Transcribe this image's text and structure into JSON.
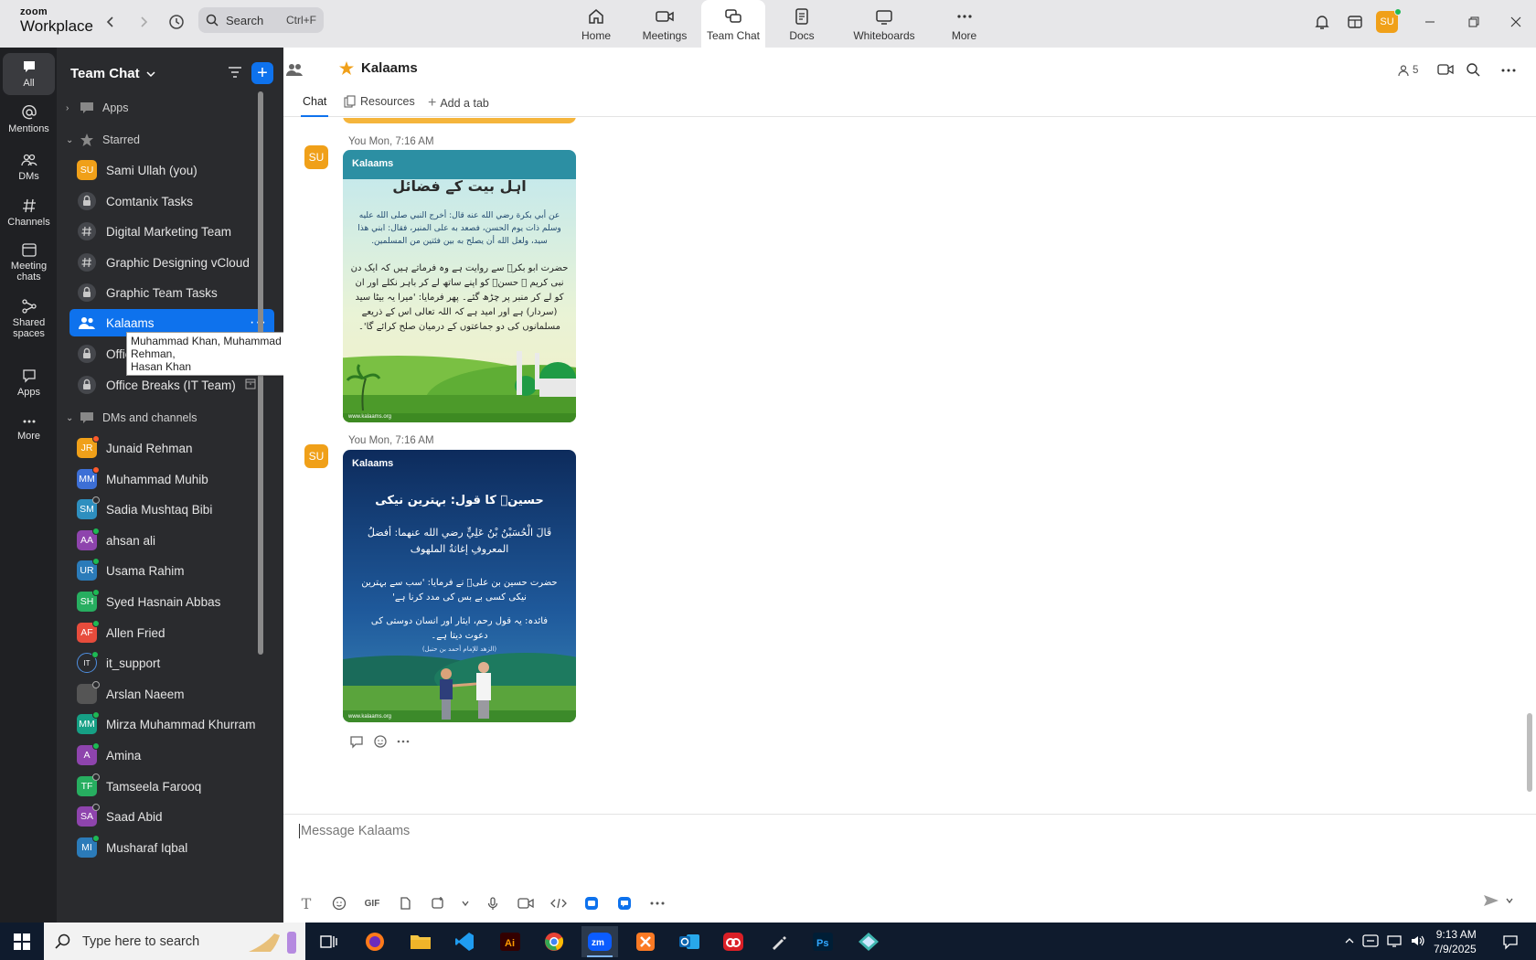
{
  "app": {
    "logo_top": "zoom",
    "logo_bottom": "Workplace"
  },
  "search": {
    "placeholder": "Search",
    "shortcut": "Ctrl+F"
  },
  "nav_tabs": [
    {
      "label": "Home",
      "icon": "home-icon"
    },
    {
      "label": "Meetings",
      "icon": "video-camera-icon"
    },
    {
      "label": "Team Chat",
      "icon": "chat-bubbles-icon",
      "active": true
    },
    {
      "label": "Docs",
      "icon": "document-icon"
    },
    {
      "label": "Whiteboards",
      "icon": "whiteboard-icon"
    },
    {
      "label": "More",
      "icon": "more-dots-icon"
    }
  ],
  "user": {
    "initials": "SU"
  },
  "rail": [
    {
      "label": "All",
      "icon": "chat-icon",
      "active": true
    },
    {
      "label": "Mentions",
      "icon": "at-icon"
    },
    {
      "label": "DMs",
      "icon": "people-icon"
    },
    {
      "label": "Channels",
      "icon": "hash-icon"
    },
    {
      "label": "Meeting chats",
      "icon": "calendar-icon"
    },
    {
      "label": "Shared spaces",
      "icon": "share-icon"
    },
    {
      "label": "Apps",
      "icon": "apps-bubble-icon"
    },
    {
      "label": "More",
      "icon": "more-dots-icon"
    }
  ],
  "sidebar": {
    "title": "Team Chat",
    "sections": {
      "apps": "Apps",
      "starred": "Starred",
      "dms": "DMs and channels"
    },
    "starred": [
      {
        "label": "Sami Ullah (you)",
        "type": "avatar",
        "initials": "SU",
        "color": "#f0a019"
      },
      {
        "label": "Comtanix Tasks",
        "type": "lock"
      },
      {
        "label": "Digital Marketing Team",
        "type": "hash"
      },
      {
        "label": "Graphic Designing vCloud",
        "type": "hash"
      },
      {
        "label": "Graphic Team Tasks",
        "type": "lock"
      },
      {
        "label": "Kalaams",
        "type": "group",
        "active": true
      },
      {
        "label": "Office",
        "type": "lock"
      },
      {
        "label": "Office Breaks (IT Team)",
        "type": "lock"
      }
    ],
    "dms": [
      {
        "label": "Junaid Rehman",
        "initials": "JR",
        "color": "#f0a019",
        "status": "red"
      },
      {
        "label": "Muhammad Muhib",
        "initials": "MM",
        "color": "#3d6fd6",
        "status": "red"
      },
      {
        "label": "Sadia Mushtaq Bibi",
        "initials": "SM",
        "color": "#2e8fbf",
        "status": "away"
      },
      {
        "label": "ahsan ali",
        "initials": "AA",
        "color": "#8e44ad",
        "status": "online"
      },
      {
        "label": "Usama Rahim",
        "initials": "UR",
        "color": "#2b7bb9",
        "status": "online"
      },
      {
        "label": "Syed Hasnain Abbas",
        "initials": "SH",
        "color": "#27ae60",
        "status": "online"
      },
      {
        "label": "Allen Fried",
        "initials": "AF",
        "color": "#e74c3c",
        "status": "online"
      },
      {
        "label": "it_support",
        "initials": "IT",
        "color": "#2a2b2e",
        "status": "online"
      },
      {
        "label": "Arslan Naeem",
        "initials": "",
        "color": "#555555",
        "status": "away"
      },
      {
        "label": "Mirza Muhammad Khurram",
        "initials": "MM",
        "color": "#16a085",
        "status": "online"
      },
      {
        "label": "Amina",
        "initials": "A",
        "color": "#8e44ad",
        "status": "online"
      },
      {
        "label": "Tamseela Farooq",
        "initials": "TF",
        "color": "#27ae60",
        "status": "away"
      },
      {
        "label": "Saad Abid",
        "initials": "SA",
        "color": "#8e44ad",
        "status": "away"
      },
      {
        "label": "Musharaf Iqbal",
        "initials": "MI",
        "color": "#2b7bb9",
        "status": "online"
      }
    ]
  },
  "tooltip": {
    "line1": "Muhammad Khan, Muhammad Muhib, Junaid Rehman,",
    "line2": "Hasan Khan"
  },
  "channel": {
    "title": "Kalaams",
    "member_count": "5",
    "tabs": [
      "Chat",
      "Resources",
      "Add a tab"
    ]
  },
  "messages": [
    {
      "meta": "You Mon, 7:16 AM",
      "initials": "SU",
      "card": {
        "brand": "Kalaams",
        "heading": "اہل بیت کے فضائل",
        "arabic": "عن أبي بكرة رضي الله عنه قال: أخرج النبي صلى الله عليه وسلم ذات يوم الحسن، فصعد به على المنبر، فقال: ابني هذا سيد، ولعل الله أن يصلح به بين فئتين من المسلمين.",
        "urdu": "حضرت ابو بکرؓ سے روایت ہے وہ فرماتے ہیں کہ ایک دن نبی کریم ﷺ حسنؓ کو اپنے ساتھ لے کر باہر نکلے اور ان کو لے کر منبر پر چڑھ گئے۔ پھر فرمایا: 'میرا یہ بیٹا سید (سردار) ہے اور امید ہے کہ اللہ تعالی اس کے ذریعے مسلمانوں کی دو جماعتوں کے درمیان صلح کرائے گا'۔",
        "footer": "www.kalaams.org"
      }
    },
    {
      "meta": "You Mon, 7:16 AM",
      "initials": "SU",
      "card": {
        "brand": "Kalaams",
        "heading": "حسینؓ کا قول: بہترین نیکی",
        "arabic": "قَالَ الْحُسَيْنُ بْنُ عَلِيٍّ رضي الله عنهما: أفضلُ المعروفِ إغاثةُ الملهوف",
        "urdu": "حضرت حسین بن علیؓ نے فرمایا: 'سب سے بہترین نیکی کسی بے بس کی مدد کرنا ہے'",
        "note": "فائدہ: یہ قول رحم، ایثار اور انسان دوستی کی دعوت دیتا ہے۔",
        "source": "(الزهد للإمام أحمد بن حنبل)",
        "footer": "www.kalaams.org"
      }
    }
  ],
  "composer": {
    "placeholder": "Message Kalaams",
    "gif_label": "GIF"
  },
  "taskbar": {
    "search_placeholder": "Type here to search",
    "time": "9:13 AM",
    "date": "7/9/2025"
  }
}
